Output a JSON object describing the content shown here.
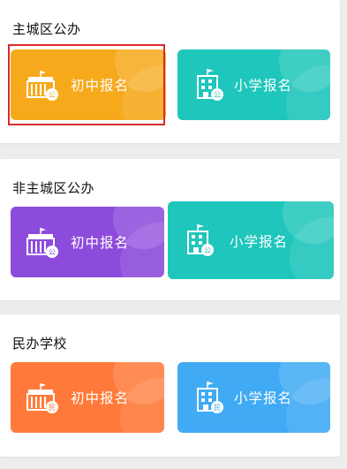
{
  "sections": [
    {
      "title": "主城区公办",
      "cards": [
        {
          "label": "初中报名",
          "badge": "公",
          "color": "#f7a91c"
        },
        {
          "label": "小学报名",
          "badge": "公",
          "color": "#1fc6bb"
        }
      ]
    },
    {
      "title": "非主城区公办",
      "cards": [
        {
          "label": "初中报名",
          "badge": "公",
          "color": "#8d4bdc"
        },
        {
          "label": "小学报名",
          "badge": "公",
          "color": "#1fc6bb"
        }
      ]
    },
    {
      "title": "民办学校",
      "cards": [
        {
          "label": "初中报名",
          "badge": "民",
          "color": "#ff7a3a"
        },
        {
          "label": "小学报名",
          "badge": "民",
          "color": "#40aaf5"
        }
      ]
    }
  ],
  "highlight_color": "#d92b2b"
}
